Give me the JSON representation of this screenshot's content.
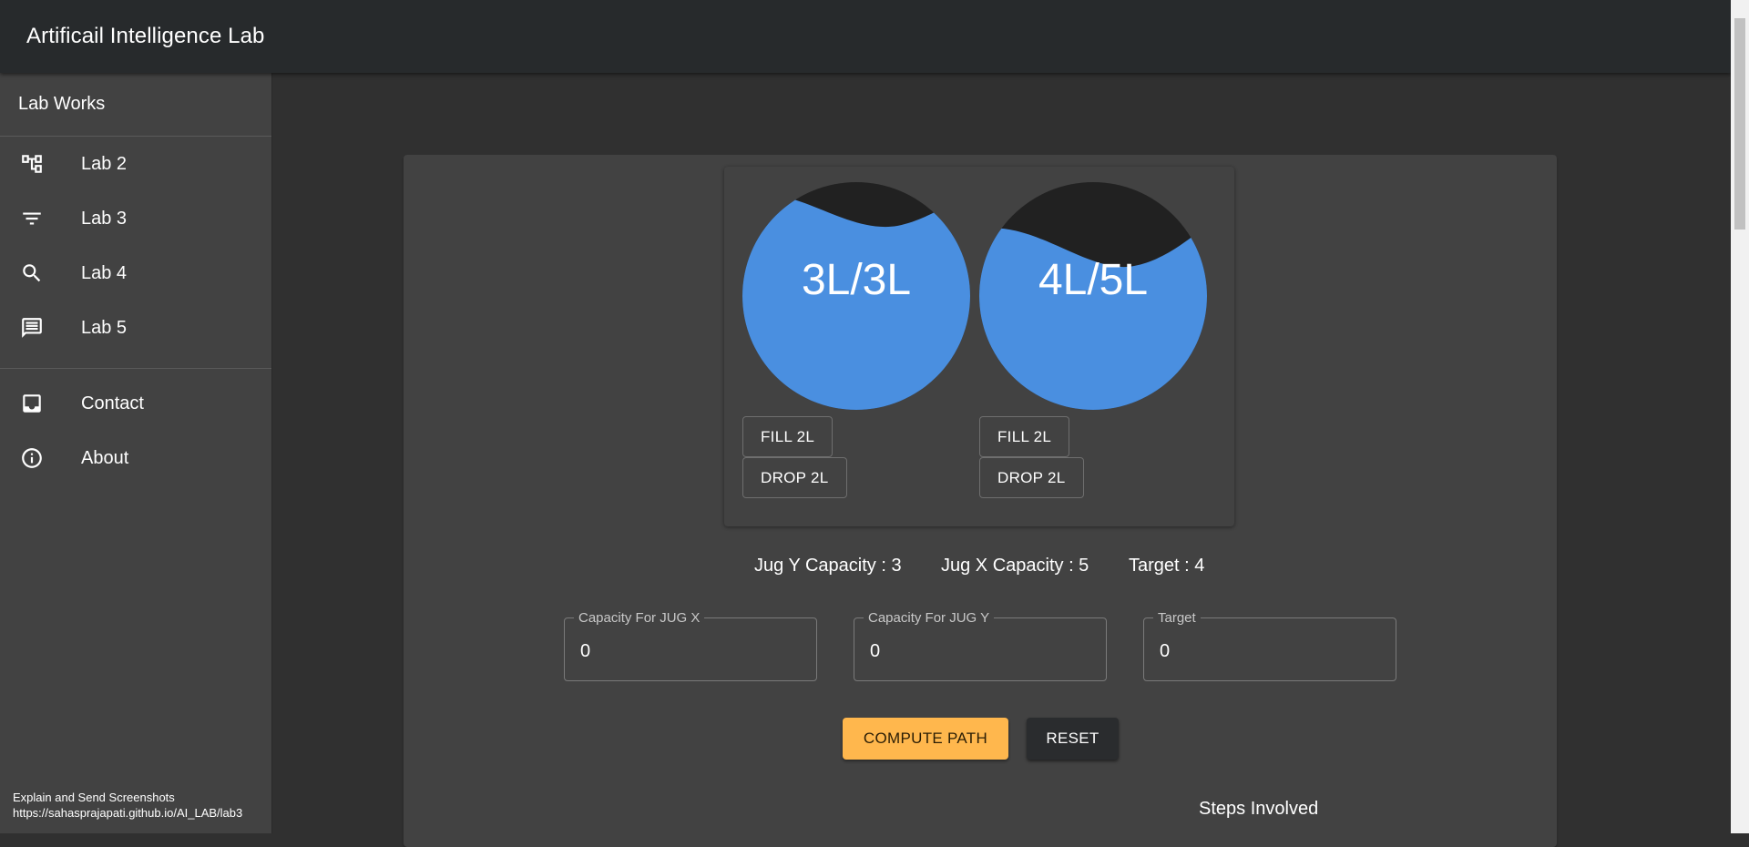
{
  "app": {
    "title": "Artificail Intelligence Lab"
  },
  "drawer": {
    "header": "Lab Works",
    "items": [
      {
        "label": "Lab 2",
        "icon": "account-tree-icon"
      },
      {
        "label": "Lab 3",
        "icon": "filter-list-icon"
      },
      {
        "label": "Lab 4",
        "icon": "search-icon"
      },
      {
        "label": "Lab 5",
        "icon": "chat-icon"
      }
    ],
    "secondary": [
      {
        "label": "Contact",
        "icon": "inbox-icon"
      },
      {
        "label": "About",
        "icon": "info-icon"
      }
    ],
    "footer": {
      "line1": "Explain and Send Screenshots",
      "line2": "https://sahasprajapati.github.io/AI_LAB/lab3"
    }
  },
  "jugs": [
    {
      "label": "3L/3L",
      "fill_fraction": 0.9,
      "fill_button": "FILL 2L",
      "drop_button": "DROP 2L"
    },
    {
      "label": "4L/5L",
      "fill_fraction": 0.75,
      "fill_button": "FILL 2L",
      "drop_button": "DROP 2L"
    }
  ],
  "info": {
    "jug_y": "Jug Y Capacity : 3",
    "jug_x": "Jug X Capacity : 5",
    "target": "Target : 4"
  },
  "fields": [
    {
      "label": "Capacity For JUG X",
      "value": "0"
    },
    {
      "label": "Capacity For JUG Y",
      "value": "0"
    },
    {
      "label": "Target",
      "value": "0"
    }
  ],
  "actions": {
    "compute": "COMPUTE PATH",
    "reset": "RESET"
  },
  "steps_title": "Steps Involved",
  "colors": {
    "water": "#4a8fe0",
    "empty": "#212121",
    "accent": "#ffb74d",
    "appbar": "#272a2c",
    "drawer": "#424242",
    "background": "#303030"
  }
}
